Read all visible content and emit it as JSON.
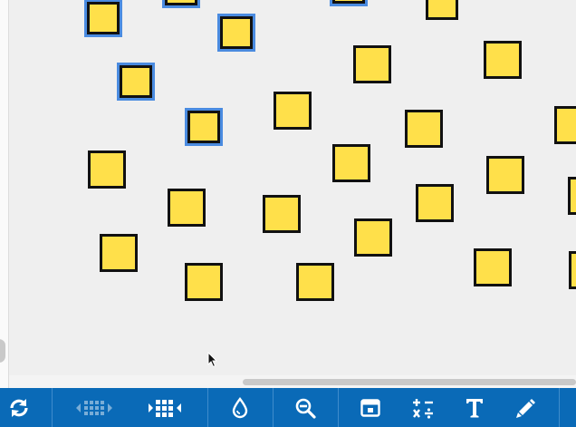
{
  "canvas": {
    "background": "#efefef",
    "square_fill": "#ffe04a",
    "square_border": "#111111",
    "selection_color": "#4a8be0"
  },
  "toolbar": {
    "background": "#0a6ab7",
    "buttons": [
      {
        "name": "refresh-button",
        "icon": "refresh-icon",
        "enabled": true
      },
      {
        "name": "grid-shrink-button",
        "icon": "grid-shrink-icon",
        "enabled": false
      },
      {
        "name": "grid-expand-button",
        "icon": "grid-expand-icon",
        "enabled": true
      },
      {
        "name": "fill-color-button",
        "icon": "droplet-icon",
        "enabled": true
      },
      {
        "name": "zoom-out-button",
        "icon": "zoom-out-icon",
        "enabled": true
      },
      {
        "name": "frame-button",
        "icon": "frame-icon",
        "enabled": true
      },
      {
        "name": "arithmetic-button",
        "icon": "arithmetic-ops-icon",
        "enabled": true
      },
      {
        "name": "text-tool-button",
        "icon": "text-icon",
        "enabled": true
      },
      {
        "name": "pen-tool-button",
        "icon": "pencil-icon",
        "enabled": true
      }
    ]
  }
}
